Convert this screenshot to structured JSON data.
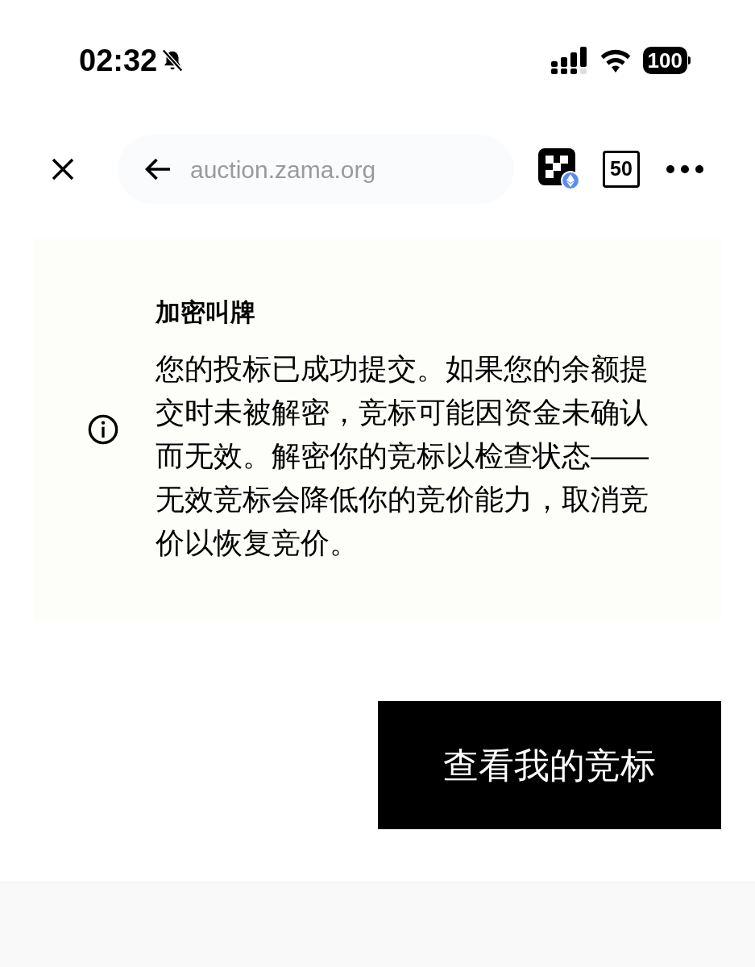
{
  "status_bar": {
    "time": "02:32",
    "battery": "100"
  },
  "browser_bar": {
    "url": "auction.zama.org",
    "tab_count": "50"
  },
  "notice": {
    "title": "加密叫牌",
    "body": "您的投标已成功提交。如果您的余额提交时未被解密，竞标可能因资金未确认而无效。解密你的竞标以检查状态——无效竞标会降低你的竞价能力，取消竞价以恢复竞价。"
  },
  "button": "查看我的竞标"
}
